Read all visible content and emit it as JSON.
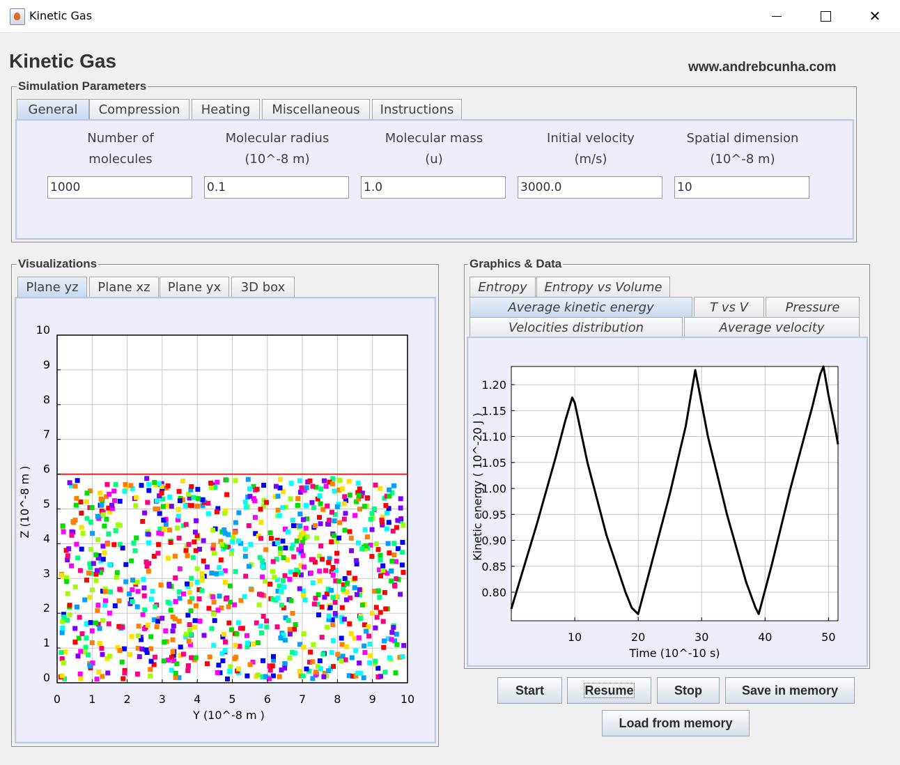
{
  "window": {
    "title": "Kinetic Gas"
  },
  "header": {
    "title": "Kinetic Gas",
    "website": "www.andrebcunha.com"
  },
  "simulation_parameters": {
    "legend": "Simulation Parameters",
    "tabs": [
      {
        "label": "General",
        "active": true
      },
      {
        "label": "Compression"
      },
      {
        "label": "Heating"
      },
      {
        "label": "Miscellaneous"
      },
      {
        "label": "Instructions"
      }
    ],
    "fields": [
      {
        "line1": "Number of",
        "line2": "molecules",
        "value": "1000"
      },
      {
        "line1": "Molecular radius",
        "line2": "(10^-8 m)",
        "value": "0.1"
      },
      {
        "line1": "Molecular mass",
        "line2": "(u)",
        "value": "1.0"
      },
      {
        "line1": "Initial velocity",
        "line2": "(m/s)",
        "value": "3000.0"
      },
      {
        "line1": "Spatial dimension",
        "line2": "(10^-8 m)",
        "value": "10"
      }
    ]
  },
  "visualizations": {
    "legend": "Visualizations",
    "tabs": [
      {
        "label": "Plane yz",
        "active": true
      },
      {
        "label": "Plane xz"
      },
      {
        "label": "Plane yx"
      },
      {
        "label": "3D box"
      }
    ],
    "scatter": {
      "type": "scatter",
      "xlabel": "Y (10^-8 m )",
      "ylabel": "Z (10^-8 m )",
      "xlim": [
        0,
        10
      ],
      "ylim": [
        0,
        10
      ],
      "xticks": [
        "0",
        "1",
        "2",
        "3",
        "4",
        "5",
        "6",
        "7",
        "8",
        "9",
        "10"
      ],
      "yticks": [
        "0",
        "1",
        "2",
        "3",
        "4",
        "5",
        "6",
        "7",
        "8",
        "9",
        "10"
      ],
      "piston_height": 6,
      "molecule_count": 1000,
      "piston_color": "#e02020",
      "colors": [
        "#ff0000",
        "#ff8000",
        "#ffe000",
        "#a0ff00",
        "#00e000",
        "#00ff80",
        "#00ffff",
        "#00a0ff",
        "#0000ff",
        "#8000ff",
        "#ff00ff",
        "#ff0080"
      ]
    }
  },
  "graphics": {
    "legend": "Graphics & Data",
    "tabs_row1": [
      {
        "label": "Entropy"
      },
      {
        "label": "Entropy vs Volume"
      }
    ],
    "tabs_row2": [
      {
        "label": "Average kinetic energy",
        "active": true
      },
      {
        "label": "T vs V"
      },
      {
        "label": "Pressure"
      }
    ],
    "tabs_row3": [
      {
        "label": "Velocities distribution"
      },
      {
        "label": "Average velocity"
      }
    ]
  },
  "chart_data": {
    "type": "line",
    "xlabel": "Time (10^-10 s)",
    "ylabel": "Kinetic energy ( 10^-20 J )",
    "xlim": [
      0,
      51.5
    ],
    "ylim": [
      0.745,
      1.235
    ],
    "xticks": [
      10,
      20,
      30,
      40,
      50
    ],
    "xticklabels": [
      "10",
      "20",
      "30",
      "40",
      "50"
    ],
    "yticks": [
      0.8,
      0.85,
      0.9,
      0.95,
      1.0,
      1.05,
      1.1,
      1.15,
      1.2
    ],
    "yticklabels": [
      "0.80",
      "0.85",
      "0.90",
      "0.95",
      "1.00",
      "1.05",
      "1.10",
      "1.15",
      "1.20"
    ],
    "grid": true,
    "series": [
      {
        "x": [
          0,
          4,
          7,
          8.5,
          9.6,
          10,
          12,
          15,
          18,
          19,
          20,
          22,
          25,
          27.5,
          28.6,
          29,
          31,
          34,
          37,
          38.5,
          39,
          41,
          44,
          47.5,
          48.7,
          49.2,
          50,
          51,
          51.5
        ],
        "y": [
          0.768,
          0.93,
          1.06,
          1.13,
          1.175,
          1.165,
          1.05,
          0.91,
          0.8,
          0.77,
          0.758,
          0.85,
          0.99,
          1.12,
          1.2,
          1.228,
          1.1,
          0.95,
          0.82,
          0.77,
          0.758,
          0.85,
          1.0,
          1.16,
          1.22,
          1.235,
          1.18,
          1.12,
          1.085
        ]
      }
    ]
  },
  "buttons": {
    "start": "Start",
    "resume": "Resume",
    "stop": "Stop",
    "save": "Save in memory",
    "load": "Load from memory"
  }
}
